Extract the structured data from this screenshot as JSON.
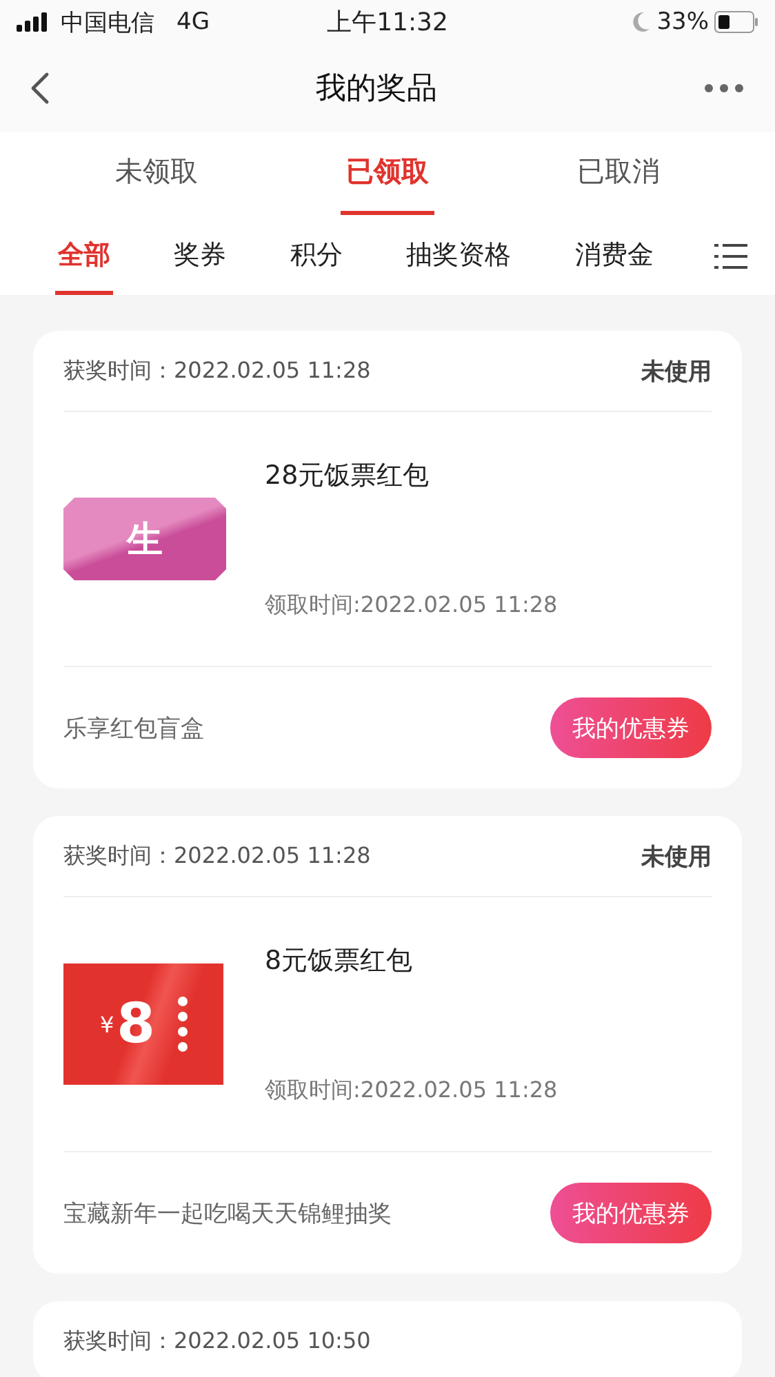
{
  "status_bar": {
    "carrier": "中国电信",
    "network": "4G",
    "time": "上午11:32",
    "battery": "33%"
  },
  "nav": {
    "title": "我的奖品"
  },
  "status_tabs": [
    {
      "label": "未领取",
      "selected": false
    },
    {
      "label": "已领取",
      "selected": true
    },
    {
      "label": "已取消",
      "selected": false
    }
  ],
  "category_tabs": [
    {
      "label": "全部",
      "selected": true
    },
    {
      "label": "奖券",
      "selected": false
    },
    {
      "label": "积分",
      "selected": false
    },
    {
      "label": "抽奖资格",
      "selected": false
    },
    {
      "label": "消费金",
      "selected": false
    }
  ],
  "prizes": [
    {
      "won_label": "获奖时间：",
      "won_time": "2022.02.05 11:28",
      "status": "未使用",
      "kind": "pink-ticket",
      "ticket_text": "生",
      "name": "28元饭票红包",
      "claimed": "领取时间:2022.02.05 11:28",
      "source": "乐享红包盲盒",
      "action": "我的优惠券"
    },
    {
      "won_label": "获奖时间：",
      "won_time": "2022.02.05 11:28",
      "status": "未使用",
      "kind": "red-ticket",
      "currency": "¥",
      "amount": "8",
      "name": "8元饭票红包",
      "claimed": "领取时间:2022.02.05 11:28",
      "source": "宝藏新年一起吃喝天天锦鲤抽奖",
      "action": "我的优惠券"
    },
    {
      "won_label": "获奖时间：",
      "won_time": "2022.02.05 10:50"
    }
  ]
}
